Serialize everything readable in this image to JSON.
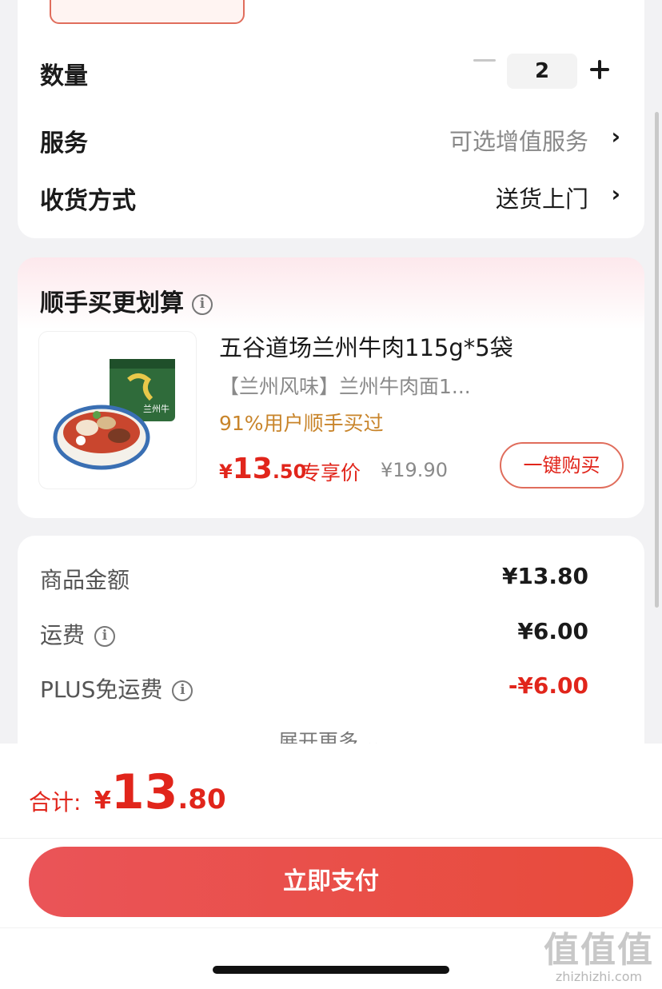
{
  "order": {
    "quantity_label": "数量",
    "quantity_value": "2",
    "service_label": "服务",
    "service_value": "可选增值服务",
    "delivery_label": "收货方式",
    "delivery_value": "送货上门",
    "chevron": "›"
  },
  "addon": {
    "title": "顺手买更划算",
    "product": {
      "name": "五谷道场兰州牛肉115g*5袋",
      "subtitle": "【兰州风味】兰州牛肉面1...",
      "users_bought": "91%用户顺手买过",
      "price_yen": "¥",
      "price_int": "13",
      "price_dec": ".50",
      "price_tag": "专享价",
      "original_price": "¥19.90",
      "buy_button": "一键购买",
      "package_text": "兰州牛"
    }
  },
  "price": {
    "rows": [
      {
        "label": "商品金额",
        "value": "¥13.80"
      },
      {
        "label": "运费",
        "value": "¥6.00"
      },
      {
        "label": "PLUS免运费",
        "value": "-¥6.00"
      }
    ],
    "expand_label": "展开更多 ⌄"
  },
  "footer": {
    "total_label": "合计:",
    "total_yen": "¥",
    "total_int": "13",
    "total_dec": ".80",
    "pay_button": "立即支付"
  },
  "watermark": {
    "chars": "值值值",
    "url": "zhizhizhi.com"
  },
  "colors": {
    "accent_red": "#e1251b",
    "pay_button": "#e84b3b",
    "users_orange": "#c8842a"
  }
}
